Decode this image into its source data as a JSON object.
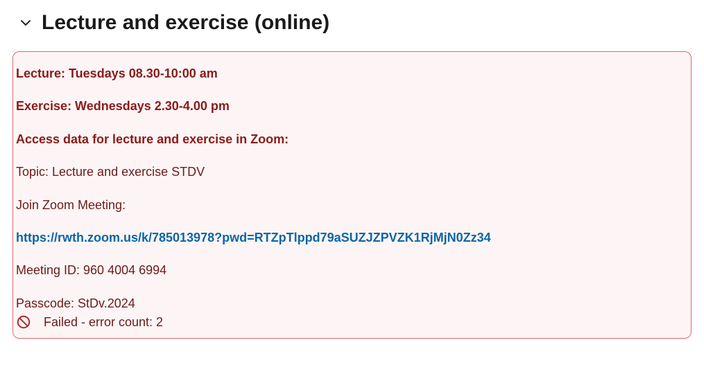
{
  "header": {
    "title": "Lecture and exercise (online)"
  },
  "panel": {
    "lecture_line": "Lecture: Tuesdays 08.30-10:00 am",
    "exercise_line": "Exercise: Wednesdays 2.30-4.00 pm",
    "access_line": "Access data for lecture and exercise in Zoom:",
    "topic_line": "Topic: Lecture and exercise STDV",
    "join_line": "Join Zoom Meeting:",
    "zoom_link": "https://rwth.zoom.us/k/785013978?pwd=RTZpTlppd79aSUZJZPVZK1RjMjN0Zz34",
    "meeting_id_line": "Meeting ID: 960 4004 6994",
    "passcode_line": "Passcode: StDv.2024",
    "status_text": "Failed - error count: 2"
  }
}
